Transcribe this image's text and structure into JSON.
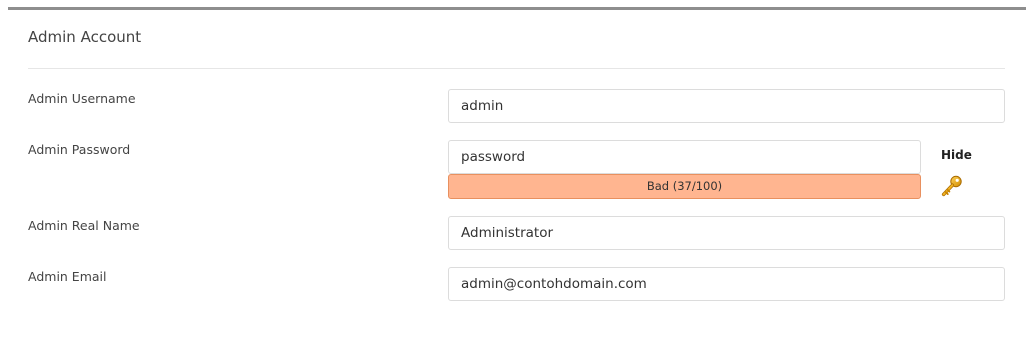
{
  "section": {
    "title": "Admin Account"
  },
  "fields": {
    "username": {
      "label": "Admin Username",
      "value": "admin"
    },
    "password": {
      "label": "Admin Password",
      "value": "password",
      "strength_text": "Bad (37/100)",
      "strength_score": 37,
      "strength_max": 100,
      "strength_color": "#ffb590",
      "toggle_label": "Hide"
    },
    "real_name": {
      "label": "Admin Real Name",
      "value": "Administrator"
    },
    "email": {
      "label": "Admin Email",
      "value": "admin@contohdomain.com"
    }
  },
  "icons": {
    "password_generator": "key-icon"
  }
}
